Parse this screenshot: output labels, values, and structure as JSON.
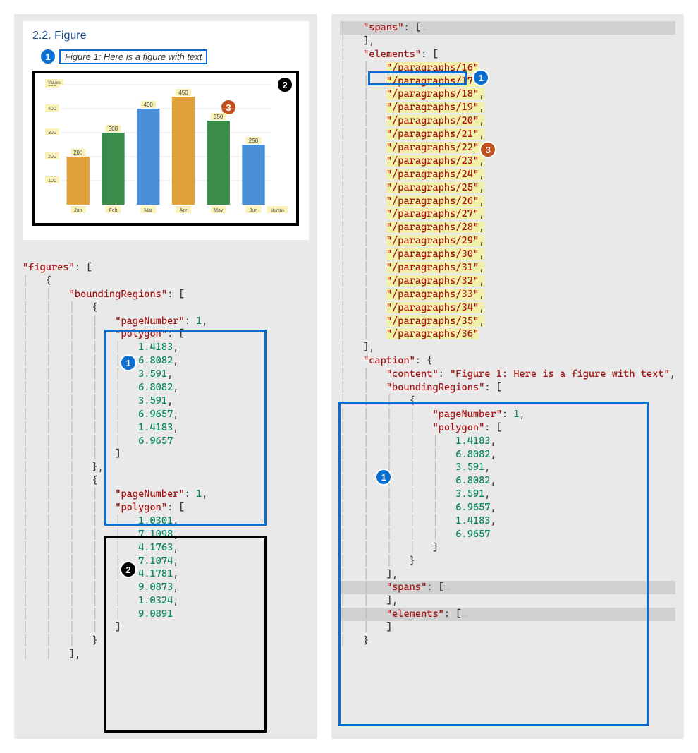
{
  "figure": {
    "heading": "2.2. Figure",
    "caption": "Figure 1: Here is a figure with text"
  },
  "chart_data": {
    "type": "bar",
    "ylabel": "Values",
    "xlabel": "Months",
    "categories": [
      "Jan",
      "Feb",
      "Mar",
      "Apr",
      "May",
      "Jun"
    ],
    "values": [
      200,
      300,
      400,
      450,
      350,
      250
    ],
    "colors": [
      "#e0a23b",
      "#3a8d4a",
      "#4a90d9",
      "#e0a23b",
      "#3a8d4a",
      "#4a90d9"
    ],
    "ylim": [
      0,
      500
    ],
    "yticks": [
      100,
      200,
      300,
      400,
      500
    ]
  },
  "annotations": {
    "one": "1",
    "two": "2",
    "three": "3"
  },
  "left_code": {
    "figures_key": "\"figures\"",
    "boundingRegions_key": "\"boundingRegions\"",
    "pageNumber_key": "\"pageNumber\"",
    "polygon_key": "\"polygon\"",
    "region1": {
      "pageNumber": "1",
      "polygon": [
        "1.4183",
        "6.8082",
        "3.591",
        "6.8082",
        "3.591",
        "6.9657",
        "1.4183",
        "6.9657"
      ]
    },
    "region2": {
      "pageNumber": "1",
      "polygon": [
        "1.0301",
        "7.1098",
        "4.1763",
        "7.1074",
        "4.1781",
        "9.0873",
        "1.0324",
        "9.0891"
      ]
    }
  },
  "right_code": {
    "spans_key": "\"spans\"",
    "elements_key": "\"elements\"",
    "caption_key": "\"caption\"",
    "content_key": "\"content\"",
    "boundingRegions_key": "\"boundingRegions\"",
    "pageNumber_key": "\"pageNumber\"",
    "polygon_key": "\"polygon\"",
    "elements_first": "\"/paragraphs/16\"",
    "elements_rest": [
      "\"/paragraphs/17\"",
      "\"/paragraphs/18\"",
      "\"/paragraphs/19\"",
      "\"/paragraphs/20\"",
      "\"/paragraphs/21\"",
      "\"/paragraphs/22\"",
      "\"/paragraphs/23\"",
      "\"/paragraphs/24\"",
      "\"/paragraphs/25\"",
      "\"/paragraphs/26\"",
      "\"/paragraphs/27\"",
      "\"/paragraphs/28\"",
      "\"/paragraphs/29\"",
      "\"/paragraphs/30\"",
      "\"/paragraphs/31\"",
      "\"/paragraphs/32\"",
      "\"/paragraphs/33\"",
      "\"/paragraphs/34\"",
      "\"/paragraphs/35\"",
      "\"/paragraphs/36\""
    ],
    "caption_content": "\"Figure 1: Here is a figure with text\"",
    "caption_region": {
      "pageNumber": "1",
      "polygon": [
        "1.4183",
        "6.8082",
        "3.591",
        "6.8082",
        "3.591",
        "6.9657",
        "1.4183",
        "6.9657"
      ]
    }
  }
}
